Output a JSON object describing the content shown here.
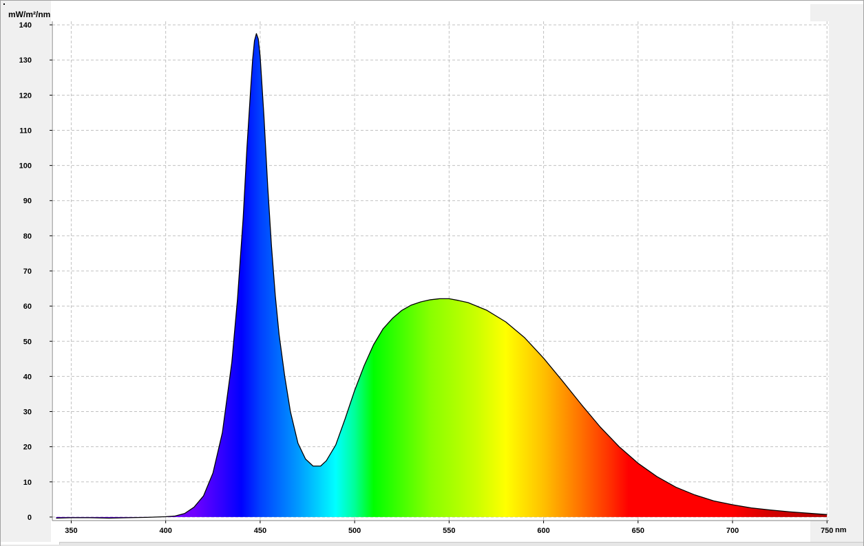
{
  "chart_data": {
    "type": "area",
    "title": "",
    "xlabel": "nm",
    "ylabel": "mW/m²/nm",
    "xlim": [
      340,
      751
    ],
    "ylim": [
      -1,
      141
    ],
    "x_ticks": [
      350,
      400,
      450,
      500,
      550,
      600,
      650,
      700,
      750
    ],
    "y_ticks": [
      0,
      10,
      20,
      30,
      40,
      50,
      60,
      70,
      80,
      90,
      100,
      110,
      120,
      130,
      140
    ],
    "grid": true,
    "legend": "none",
    "fill": "visible-spectrum-gradient",
    "colors": {
      "line": "#000000",
      "grid": "#c0c0c0",
      "spectrum_380": "#6a00ff",
      "spectrum_440": "#0000ff",
      "spectrum_490": "#00ffff",
      "spectrum_510": "#00ff00",
      "spectrum_580": "#ffff00",
      "spectrum_645": "#ff0000",
      "spectrum_750": "#b00000"
    },
    "series": [
      {
        "x": [
          342,
          350,
          360,
          370,
          380,
          390,
          400,
          405,
          410,
          415,
          420,
          425,
          430,
          435,
          438,
          441,
          443,
          445,
          446,
          447,
          448,
          449,
          450,
          452,
          454,
          456,
          458,
          460,
          463,
          466,
          470,
          474,
          478,
          482,
          485,
          490,
          495,
          500,
          505,
          510,
          515,
          520,
          525,
          530,
          535,
          540,
          545,
          550,
          555,
          560,
          570,
          580,
          590,
          600,
          610,
          620,
          630,
          640,
          650,
          660,
          670,
          680,
          690,
          700,
          710,
          720,
          730,
          740,
          745,
          750
        ],
        "y": [
          -0.3,
          -0.2,
          -0.2,
          -0.3,
          -0.2,
          -0.1,
          0.1,
          0.3,
          1.0,
          2.8,
          6.0,
          12.5,
          24.0,
          44.0,
          62.0,
          85.0,
          105.0,
          122.0,
          130.0,
          135.5,
          137.5,
          136.0,
          131.0,
          114.0,
          94.0,
          77.0,
          63.0,
          52.0,
          40.0,
          30.0,
          21.0,
          16.5,
          14.5,
          14.5,
          16.0,
          20.5,
          28.0,
          36.0,
          43.0,
          49.0,
          53.5,
          56.5,
          58.8,
          60.3,
          61.2,
          61.8,
          62.1,
          62.1,
          61.6,
          61.0,
          58.8,
          55.5,
          51.0,
          45.2,
          38.7,
          32.0,
          25.6,
          20.0,
          15.3,
          11.5,
          8.5,
          6.3,
          4.6,
          3.5,
          2.6,
          2.0,
          1.5,
          1.1,
          0.9,
          0.7
        ]
      }
    ]
  }
}
